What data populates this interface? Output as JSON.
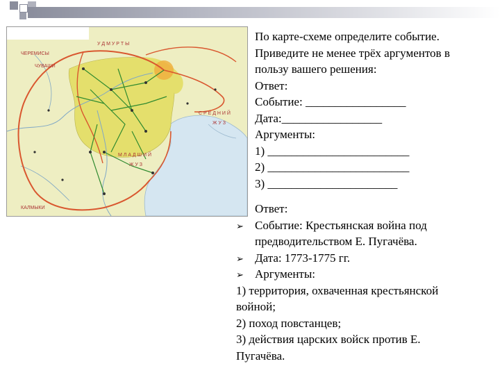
{
  "question": {
    "line1": "По карте-схеме определите событие.",
    "line2": "Приведите не менее трёх аргументов в",
    "line3": "пользу вашего решения:",
    "answer_label": "Ответ:",
    "event_line": "Событие: _________________",
    "date_line": "Дата:_________________",
    "args_label": "Аргументы:",
    "arg1": "1) ________________________",
    "arg2": "2) ________________________",
    "arg3": "3) ______________________"
  },
  "answer": {
    "label": "Ответ:",
    "event_a": "Событие: Крестьянская война под",
    "event_b": "предводительством Е. Пугачёва.",
    "date": "Дата: 1773-1775 гг.",
    "args": "Аргументы:",
    "a1a": "1) территория, охваченная крестьянской",
    "a1b": "войной;",
    "a2": "2) поход повстанцев;",
    "a3a": "3) действия царских войск против Е.",
    "a3b": "Пугачёва."
  },
  "map_labels": {
    "udmurty": "У Д М У Р Т Ы",
    "cheremisy": "ЧЕРЕМИСЫ",
    "chuvashi": "ЧУВАШИ",
    "srednij": "С Р Е Д Н И Й",
    "zhuz1": "Ж У З",
    "mladshij": "М Л А Д Ш И Й",
    "zhuz2": "Ж У З",
    "kalmyki": "КАЛМЫКИ"
  },
  "colors": {
    "map_land": "#eeeec2",
    "map_sea": "#d5e6f1",
    "rebel_area": "#e4df6c",
    "rebel_route": "#d9572f",
    "tsar_route": "#2f8a2f"
  }
}
